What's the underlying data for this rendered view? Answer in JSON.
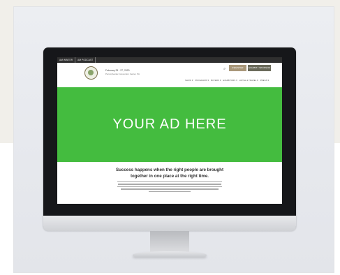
{
  "site": {
    "top_links": [
      "AM WINTER",
      "AM PODCAST"
    ],
    "event_dates": "February 25 - 27, 2020",
    "venue": "Pennsylvania Convention Center, PA",
    "register_label": "REGISTER",
    "exhibit_label": "EXHIBIT / SPONSOR",
    "nav": [
      "SHOW ▾",
      "PROGRAMS ▾",
      "BUYERS ▾",
      "EXHIBITORS ▾",
      "HOTEL & TRAVEL ▾",
      "PRESS ▾"
    ],
    "hero_text": "YOUR AD HERE",
    "headline": "Success happens when the right people are brought together in one place at the right time.",
    "body_text": "The largest American and Canadian handmade wholesale show, for buyers looking to source the work of traditional and modern craft, American Made offers direct access to one-of-a-kind pieces with a unique story behind the products and the maker. Gathering annually in the city of love, Philadelphia, buyers have the convenient experience of discovering authentic products from the individually and self-expression."
  },
  "icons": {
    "search": "search-icon",
    "logo": "brand-logo-seal"
  },
  "colors": {
    "hero_green": "#44bc3f",
    "register_btn": "#a9987a",
    "exhibit_btn": "#6b6b5b"
  }
}
